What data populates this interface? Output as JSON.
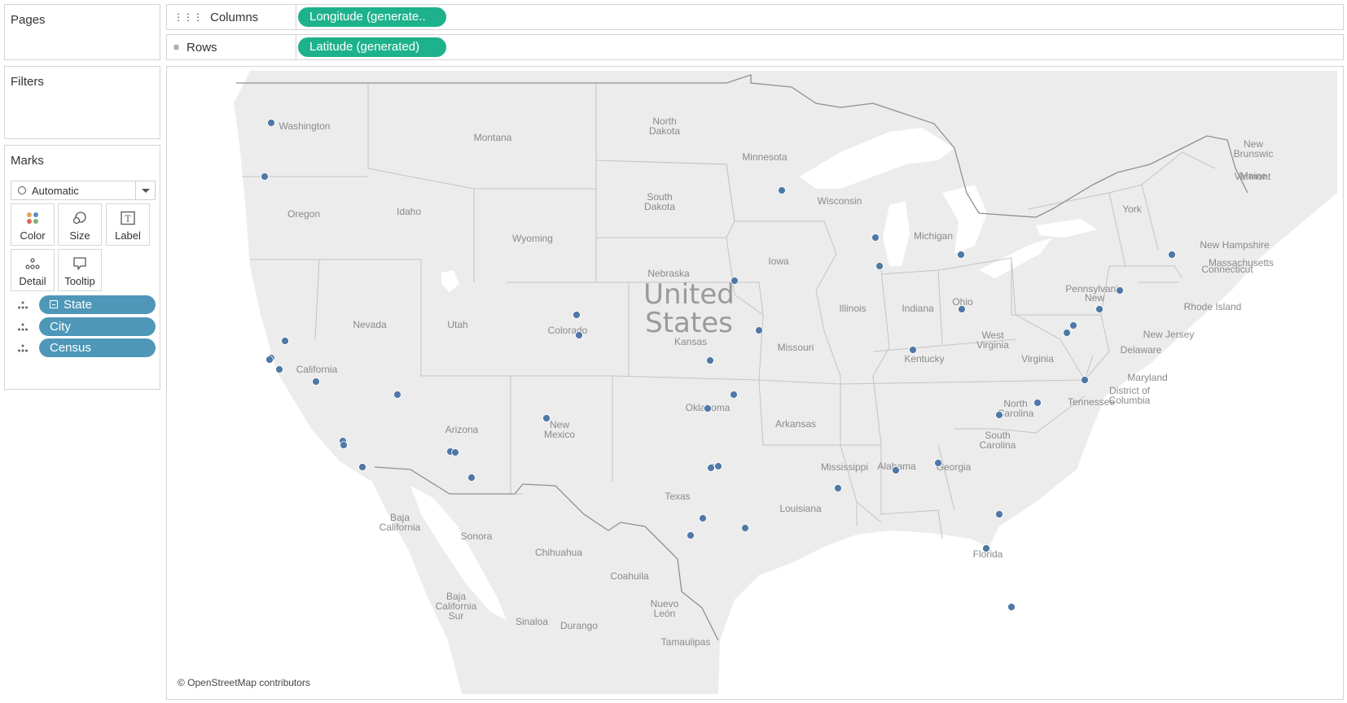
{
  "pages": {
    "title": "Pages"
  },
  "filters": {
    "title": "Filters"
  },
  "marks": {
    "title": "Marks",
    "mark_type": "Automatic",
    "buttons": {
      "color": "Color",
      "size": "Size",
      "label": "Label",
      "detail": "Detail",
      "tooltip": "Tooltip"
    },
    "fields": {
      "state": "State",
      "city": "City",
      "census": "Census"
    }
  },
  "shelves": {
    "columns_label": "Columns",
    "columns_pill": "Longitude (generate..",
    "rows_label": "Rows",
    "rows_pill": "Latitude (generated)"
  },
  "map": {
    "country_label_line1": "United",
    "country_label_line2": "States",
    "attribution": "© OpenStreetMap contributors",
    "labels": [
      {
        "text": "Washington"
      },
      {
        "text": "Montana"
      },
      {
        "text": "North"
      },
      {
        "text": "Dakota"
      },
      {
        "text": "Minnesota"
      },
      {
        "text": "Oregon"
      },
      {
        "text": "Idaho"
      },
      {
        "text": "South"
      },
      {
        "text": "Dakota"
      },
      {
        "text": "Wisconsin"
      },
      {
        "text": "Wyoming"
      },
      {
        "text": "Michigan"
      },
      {
        "text": "Nebraska"
      },
      {
        "text": "Iowa"
      },
      {
        "text": "Nevada"
      },
      {
        "text": "Utah"
      },
      {
        "text": "Colorado"
      },
      {
        "text": "Kansas"
      },
      {
        "text": "Illinois"
      },
      {
        "text": "Indiana"
      },
      {
        "text": "Ohio"
      },
      {
        "text": "Missouri"
      },
      {
        "text": "California"
      },
      {
        "text": "Kentucky"
      },
      {
        "text": "West"
      },
      {
        "text": "Virginia"
      },
      {
        "text": "Virginia"
      },
      {
        "text": "Pennsylvania"
      },
      {
        "text": "New"
      },
      {
        "text": "York"
      },
      {
        "text": "Vermont"
      },
      {
        "text": "Maine"
      },
      {
        "text": "New"
      },
      {
        "text": "Brunswic"
      },
      {
        "text": "New Hampshire"
      },
      {
        "text": "Massachusetts"
      },
      {
        "text": "Connecticut"
      },
      {
        "text": "Rhode Island"
      },
      {
        "text": "New Jersey"
      },
      {
        "text": "Delaware"
      },
      {
        "text": "Maryland"
      },
      {
        "text": "District of"
      },
      {
        "text": "Columbia"
      },
      {
        "text": "Tennessee"
      },
      {
        "text": "North"
      },
      {
        "text": "Carolina"
      },
      {
        "text": "South"
      },
      {
        "text": "Carolina"
      },
      {
        "text": "Arizona"
      },
      {
        "text": "New"
      },
      {
        "text": "Mexico"
      },
      {
        "text": "Oklahoma"
      },
      {
        "text": "Arkansas"
      },
      {
        "text": "Mississippi"
      },
      {
        "text": "Alabama"
      },
      {
        "text": "Georgia"
      },
      {
        "text": "Texas"
      },
      {
        "text": "Louisiana"
      },
      {
        "text": "Florida"
      },
      {
        "text": "Baja"
      },
      {
        "text": "California"
      },
      {
        "text": "Sonora"
      },
      {
        "text": "Chihuahua"
      },
      {
        "text": "Coahuila"
      },
      {
        "text": "Nuevo"
      },
      {
        "text": "León"
      },
      {
        "text": "Baja"
      },
      {
        "text": "California"
      },
      {
        "text": "Sur"
      },
      {
        "text": "Sinaloa"
      },
      {
        "text": "Durango"
      },
      {
        "text": "Tamaulipas"
      }
    ],
    "colors": {
      "land": "#ececec",
      "water": "#ffffff",
      "mark": "#4e79a7",
      "border": "#bdbdbd",
      "country_border": "#8f8f8f",
      "label": "#8a8a8a"
    }
  }
}
